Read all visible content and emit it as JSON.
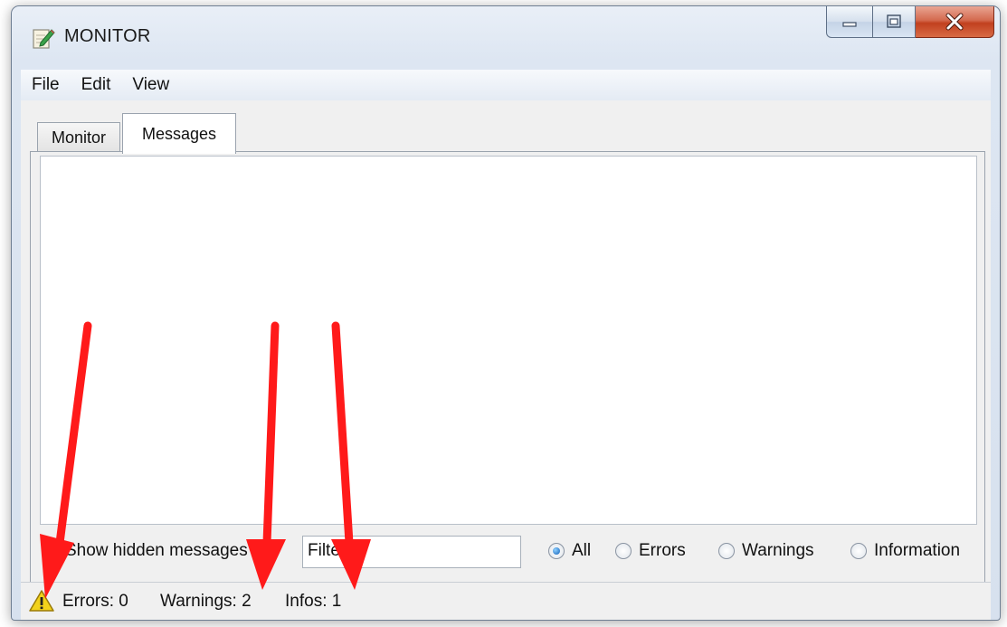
{
  "window": {
    "title": "MONITOR",
    "icons": {
      "app": "pencil-notepad-icon",
      "minimize": "minimize-icon",
      "maximize": "maximize-icon",
      "close": "close-icon"
    }
  },
  "menu": [
    "File",
    "Edit",
    "View"
  ],
  "tabs": [
    {
      "label": "Monitor",
      "active": false
    },
    {
      "label": "Messages",
      "active": true
    }
  ],
  "filters": {
    "show_hidden_label": "Show hidden messages",
    "show_hidden_checked": false,
    "filter_label": "Filter",
    "filter_value": "",
    "radios": [
      {
        "label": "All",
        "checked": true
      },
      {
        "label": "Errors",
        "checked": false
      },
      {
        "label": "Warnings",
        "checked": false
      },
      {
        "label": "Information",
        "checked": false
      }
    ]
  },
  "status": {
    "icon": "warning-triangle-icon",
    "errors": "Errors: 0",
    "warnings": "Warnings: 2",
    "infos": "Infos: 1"
  },
  "colors": {
    "annotation_arrow": "#ff1a1a",
    "warning": "#f2d21b",
    "accent": "#1f6fd1"
  }
}
